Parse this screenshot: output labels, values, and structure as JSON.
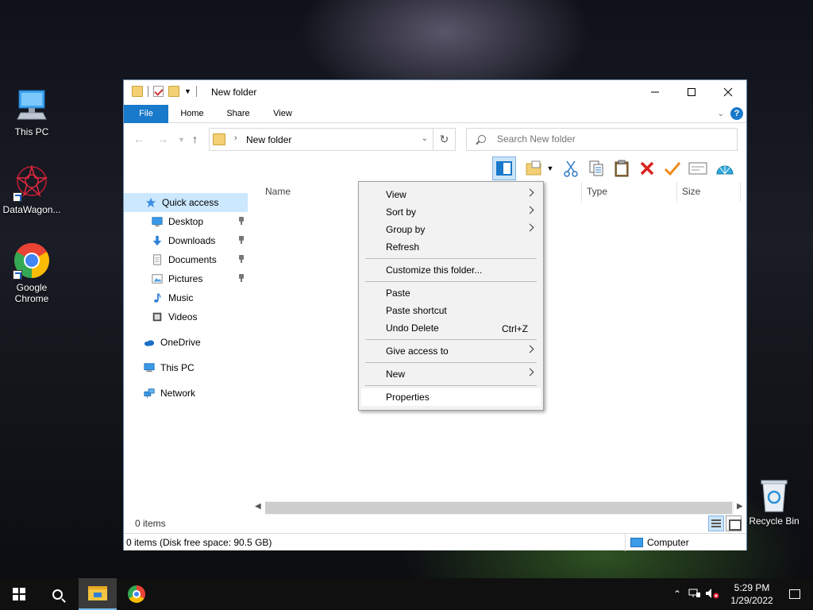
{
  "desktop": {
    "icons": [
      {
        "label": "This PC"
      },
      {
        "label": "DataWagon..."
      },
      {
        "label": "Google\nChrome"
      },
      {
        "label": "Recycle Bin"
      }
    ]
  },
  "window": {
    "title": "New folder",
    "tabs": [
      "File",
      "Home",
      "Share",
      "View"
    ],
    "help": "?",
    "address": "New folder",
    "search_placeholder": "Search New folder",
    "nav": [
      {
        "label": "Quick access",
        "icon": "star-icon"
      },
      {
        "label": "Desktop",
        "icon": "desktop-icon",
        "pinned": true
      },
      {
        "label": "Downloads",
        "icon": "download-icon",
        "pinned": true
      },
      {
        "label": "Documents",
        "icon": "documents-icon",
        "pinned": true
      },
      {
        "label": "Pictures",
        "icon": "pictures-icon",
        "pinned": true
      },
      {
        "label": "Music",
        "icon": "music-icon"
      },
      {
        "label": "Videos",
        "icon": "videos-icon"
      },
      {
        "label": "OneDrive",
        "icon": "cloud-icon"
      },
      {
        "label": "This PC",
        "icon": "computer-icon"
      },
      {
        "label": "Network",
        "icon": "network-icon"
      }
    ],
    "columns": [
      "Name",
      "Type",
      "Size"
    ],
    "item_count": "0 items",
    "status": "0 items (Disk free space: 90.5 GB)",
    "status_location": "Computer"
  },
  "context_menu": {
    "groups": [
      [
        {
          "label": "View",
          "submenu": true
        },
        {
          "label": "Sort by",
          "submenu": true
        },
        {
          "label": "Group by",
          "submenu": true
        },
        {
          "label": "Refresh"
        }
      ],
      [
        {
          "label": "Customize this folder..."
        }
      ],
      [
        {
          "label": "Paste"
        },
        {
          "label": "Paste shortcut"
        },
        {
          "label": "Undo Delete",
          "shortcut": "Ctrl+Z"
        }
      ],
      [
        {
          "label": "Give access to",
          "submenu": true
        }
      ],
      [
        {
          "label": "New",
          "submenu": true
        }
      ],
      [
        {
          "label": "Properties"
        }
      ]
    ]
  },
  "taskbar": {
    "time": "5:29 PM",
    "date": "1/29/2022"
  },
  "colors": {
    "accent": "#1979ca",
    "selection": "#cce8ff"
  }
}
